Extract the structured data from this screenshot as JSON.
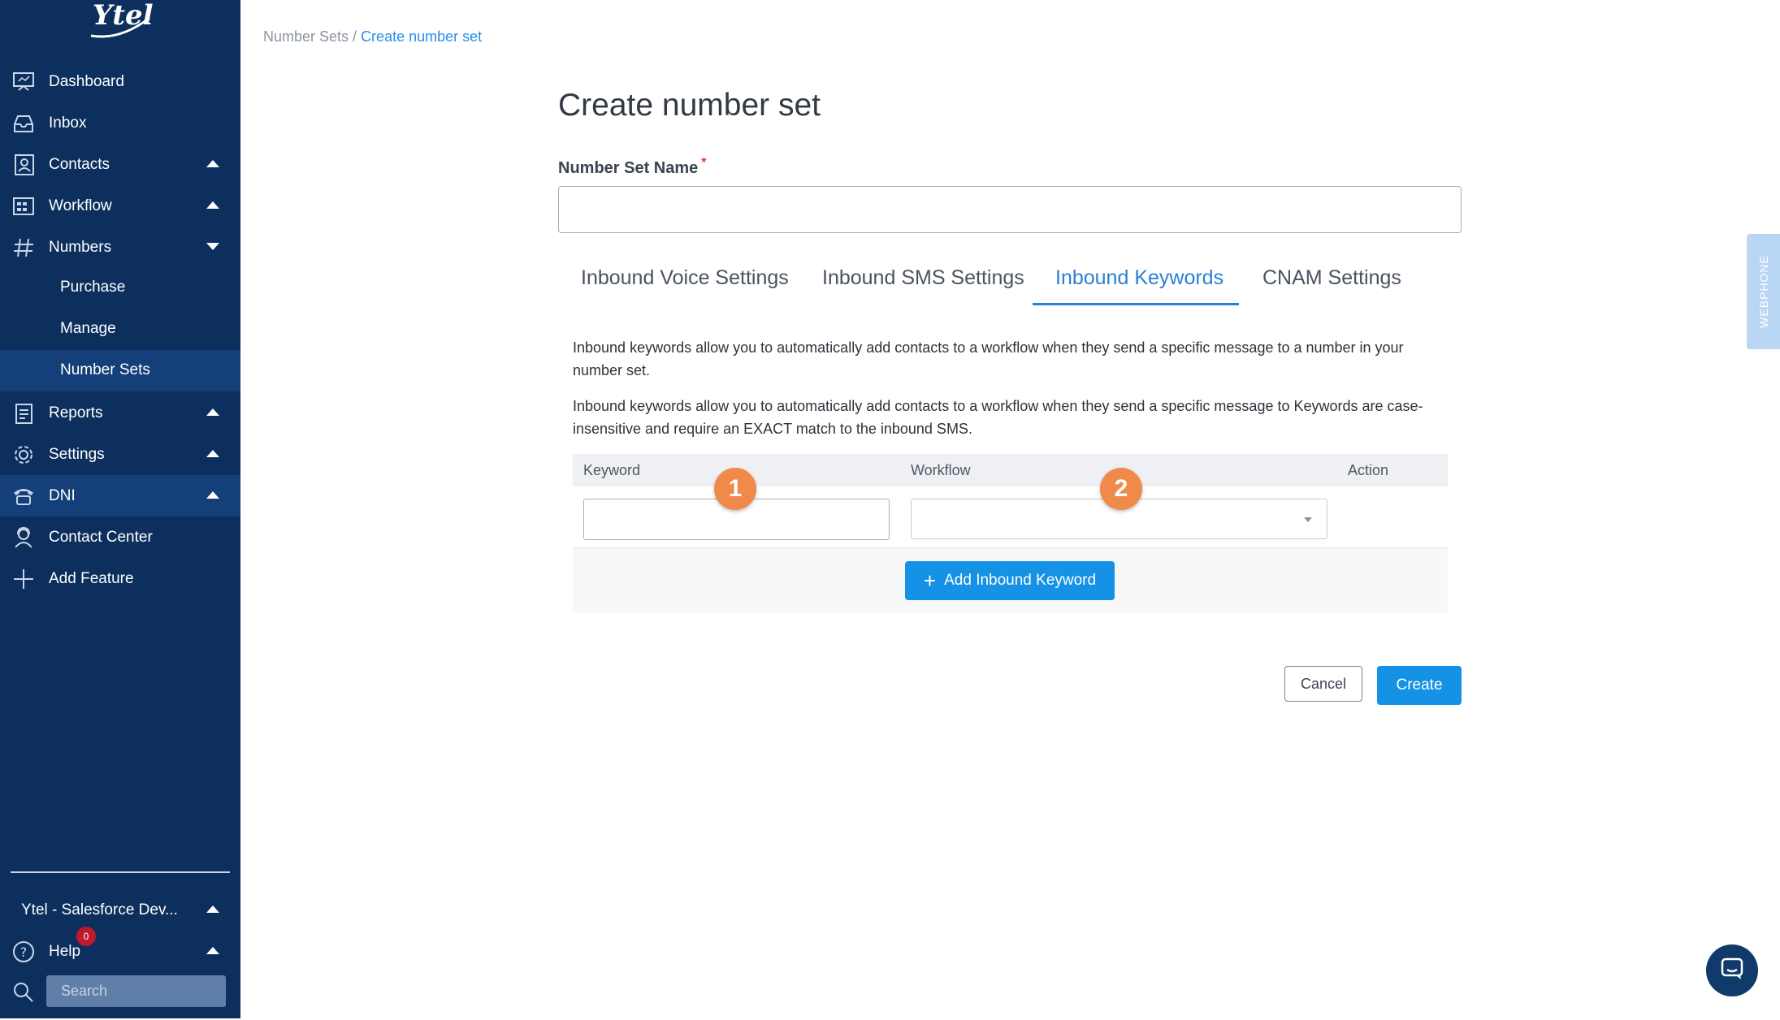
{
  "brand": {
    "logo_text": "Ytel"
  },
  "sidebar": {
    "items": [
      {
        "label": "Dashboard",
        "icon": "dashboard-icon"
      },
      {
        "label": "Inbox",
        "icon": "inbox-icon"
      },
      {
        "label": "Contacts",
        "icon": "contacts-icon",
        "caret": "up"
      },
      {
        "label": "Workflow",
        "icon": "workflow-icon",
        "caret": "up"
      },
      {
        "label": "Numbers",
        "icon": "hash-icon",
        "caret": "down",
        "children": [
          {
            "label": "Purchase"
          },
          {
            "label": "Manage"
          },
          {
            "label": "Number Sets",
            "active": true
          }
        ]
      },
      {
        "label": "Reports",
        "icon": "reports-icon",
        "caret": "up"
      },
      {
        "label": "Settings",
        "icon": "gear-icon",
        "caret": "up"
      },
      {
        "label": "DNI",
        "icon": "phone-icon",
        "caret": "up",
        "active": true
      },
      {
        "label": "Contact Center",
        "icon": "headset-icon"
      },
      {
        "label": "Add Feature",
        "icon": "plus-icon"
      }
    ],
    "account": {
      "label": "Ytel - Salesforce Dev..."
    },
    "help": {
      "label": "Help",
      "badge": "0"
    },
    "search": {
      "placeholder": "Search"
    }
  },
  "breadcrumb": {
    "parent": "Number Sets",
    "separator": " / ",
    "current": "Create number set"
  },
  "page": {
    "title": "Create number set",
    "name_field": {
      "label": "Number Set Name",
      "required_mark": "*",
      "value": ""
    },
    "tabs": [
      {
        "label": "Inbound Voice Settings"
      },
      {
        "label": "Inbound SMS Settings"
      },
      {
        "label": "Inbound Keywords",
        "active": true
      },
      {
        "label": "CNAM Settings"
      }
    ],
    "description_1": "Inbound keywords allow you to automatically add contacts to a workflow when they send a specific message to a number in your number set.",
    "description_2": "Inbound keywords allow you to automatically add contacts to a workflow when they send a specific message to Keywords are case-insensitive and require an EXACT match to the inbound SMS.",
    "table": {
      "columns": [
        "Keyword",
        "Workflow",
        "Action"
      ],
      "row": {
        "keyword": "",
        "workflow": ""
      },
      "add_button": "Add Inbound Keyword"
    },
    "markers": [
      "1",
      "2"
    ],
    "cancel_label": "Cancel",
    "create_label": "Create"
  },
  "webphone_label": "WEBPHONE",
  "colors": {
    "sidebar": "#0c2f5e",
    "accent": "#1591e6",
    "marker": "#f08a4b"
  }
}
